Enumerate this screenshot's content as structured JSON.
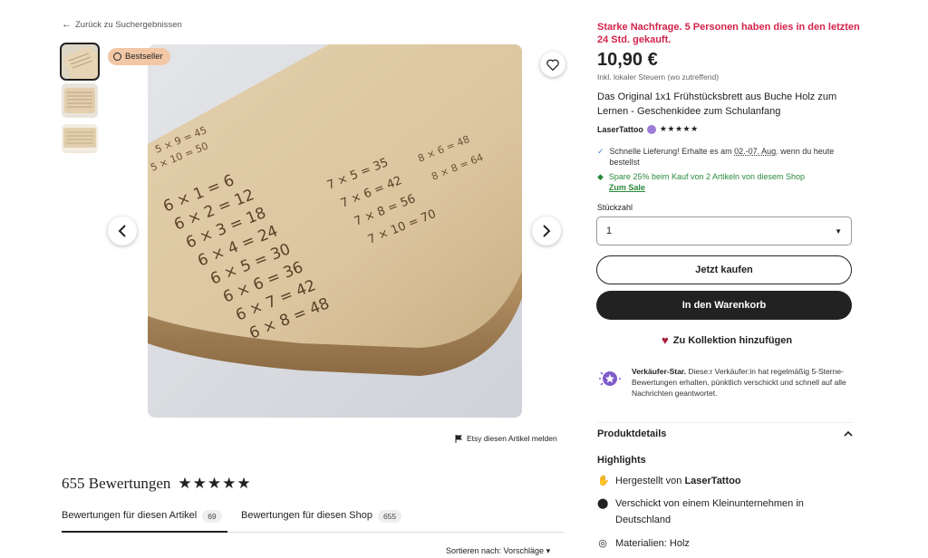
{
  "back": {
    "label": "Zurück zu Suchergebnissen"
  },
  "badge": {
    "label": "Bestseller"
  },
  "report": {
    "label": "Etsy diesen Artikel melden"
  },
  "reviews": {
    "title": "655 Bewertungen",
    "stars": "★★★★★",
    "tabs": [
      {
        "label": "Bewertungen für diesen Artikel",
        "count": "69"
      },
      {
        "label": "Bewertungen für diesen Shop",
        "count": "655"
      }
    ],
    "sort_label": "Sortieren nach: Vorschläge ▾"
  },
  "product": {
    "demand": "Starke Nachfrage. 5 Personen haben dies in den letzten 24 Std. gekauft.",
    "price": "10,90 €",
    "tax": "Inkl. lokaler Steuern (wo zutreffend)",
    "title": "Das Original 1x1 Frühstücksbrett aus Buche Holz zum Lernen - Geschenkidee zum Schulanfang",
    "shop_name": "LaserTattoo",
    "shop_stars": "★★★★★",
    "shipping_a": "Schnelle Lieferung! Erhalte es am ",
    "shipping_date": "02.-07. Aug.",
    "shipping_b": " wenn du heute bestellst",
    "sale_text": "Spare 25% beim Kauf von 2 Artikeln von diesem Shop",
    "sale_link": "Zum Sale",
    "qty_label": "Stückzahl",
    "qty_value": "1",
    "buy_now": "Jetzt kaufen",
    "add_cart": "In den Warenkorb",
    "add_collection": "Zu Kollektion hinzufügen",
    "star_seller_title": "Verkäufer-Star.",
    "star_seller_text": " Diese:r Verkäufer:in hat regelmäßig 5-Sterne-Bewertungen erhalten, pünktlich verschickt und schnell auf alle Nachrichten geantwortet.",
    "details_title": "Produktdetails",
    "highlights_title": "Highlights",
    "highlight_made": "Hergestellt von ",
    "highlight_made_by": "LaserTattoo",
    "highlight_ship": "Verschickt von einem Kleinunternehmen in Deutschland",
    "highlight_material": "Materialien: Holz"
  }
}
